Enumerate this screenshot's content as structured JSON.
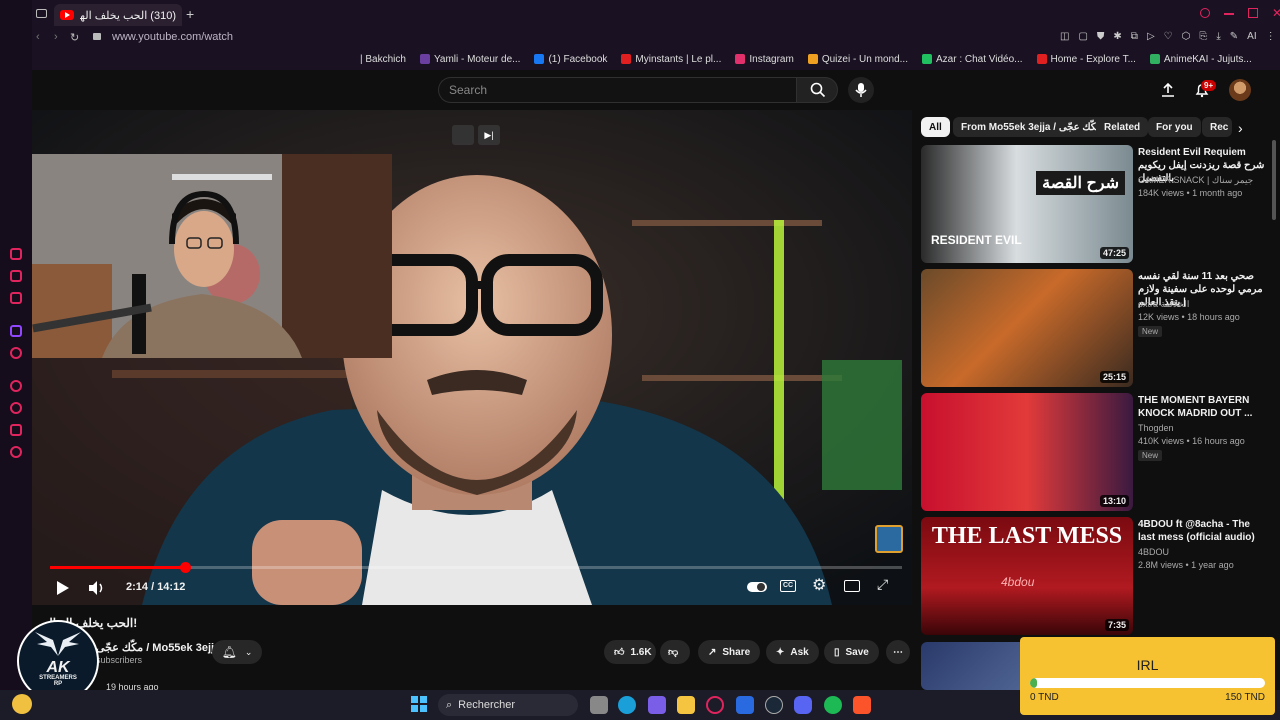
{
  "browser": {
    "active_tab_title": "(310) الحب يخلف الهبال!",
    "url": "www.youtube.com/watch",
    "bookmarks": [
      {
        "label": "| Bakchich",
        "color": "#888888"
      },
      {
        "label": "Yamli - Moteur de...",
        "color": "#6b3fa0"
      },
      {
        "label": "(1) Facebook",
        "color": "#1877f2"
      },
      {
        "label": "Myinstants | Le pl...",
        "color": "#e02020"
      },
      {
        "label": "Instagram",
        "color": "#e1306c"
      },
      {
        "label": "Quizei - Un mond...",
        "color": "#f0a020"
      },
      {
        "label": "Azar : Chat Vidéo...",
        "color": "#20c060"
      },
      {
        "label": "Home - Explore T...",
        "color": "#e02020"
      },
      {
        "label": "AnimeKAI - Jujuts...",
        "color": "#30b060"
      }
    ],
    "ai_label": "AI"
  },
  "youtube": {
    "search_placeholder": "Search",
    "notifications_badge": "9+",
    "chips": [
      "All",
      "From Mo55ek 3ejja / مكّك عجّى",
      "Related",
      "For you",
      "Rec"
    ],
    "player": {
      "time": "2:14 / 14:12",
      "progress_fraction": 0.159
    },
    "video": {
      "title": "الحب يخلف الهبال!",
      "channel": "مكّك عجّى / Mo55ek 3ejja",
      "subscribers": "subscribers",
      "posted": "19 hours ago",
      "likes": "1.6K",
      "share_label": "Share",
      "ask_label": "Ask",
      "save_label": "Save"
    },
    "recommendations": [
      {
        "title": "Resident Evil Requiem شرح قصة ريزدنت إيفل ريكويم بالتفصيل",
        "channel": "GAMER SNACK | جيمر سناك",
        "meta": "184K views • 1 month ago",
        "duration": "47:25",
        "new": "",
        "thumb_text": "شرح القصة",
        "thumb_sub": "RESIDENT EVIL"
      },
      {
        "title": "صحي بعد 11 سنة لقي نفسه مرمي لوحده على سفينة ولازم ينقذ العالم |",
        "channel": "extra الخلاصة",
        "meta": "12K views • 18 hours ago",
        "duration": "25:15",
        "new": "New",
        "thumb_text": "",
        "thumb_sub": ""
      },
      {
        "title": "THE MOMENT BAYERN KNOCK MADRID OUT ...",
        "channel": "Thogden",
        "meta": "410K views • 16 hours ago",
        "duration": "13:10",
        "new": "New",
        "thumb_text": "",
        "thumb_sub": ""
      },
      {
        "title": "4BDOU ft @8acha - The last mess (official audio)",
        "channel": "4BDOU",
        "meta": "2.8M views • 1 year ago",
        "duration": "7:35",
        "new": "",
        "thumb_text": "THE LAST MESS",
        "thumb_sub": "4bdou"
      }
    ]
  },
  "overlay": {
    "logo_text": "AK",
    "logo_sub": "STREAMERS",
    "logo_sub2": "RP",
    "donation_label": "IRL",
    "donation_min": "0 TND",
    "donation_max": "150 TND",
    "donation_fraction": 0.03
  },
  "taskbar": {
    "search_label": "Rechercher"
  },
  "colors": {
    "accent": "#ff0000",
    "opera": "#e0245e",
    "donation_bg": "#f7c232"
  }
}
